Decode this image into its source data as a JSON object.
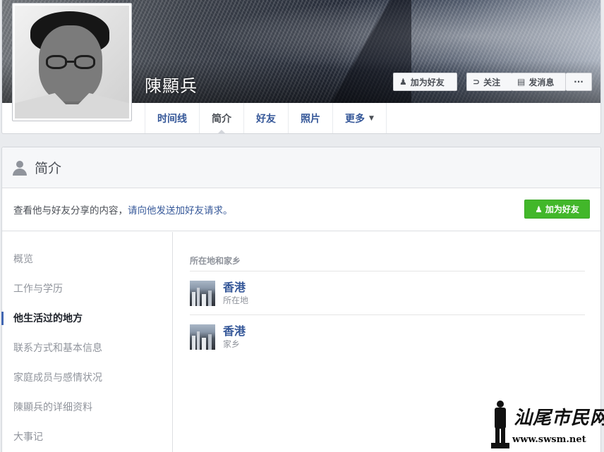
{
  "profile": {
    "name": "陳顯兵",
    "buttons": {
      "add_friend": "加为好友",
      "follow": "关注",
      "message": "发消息",
      "more": "···"
    },
    "icons": {
      "add_friend": "add-friend-icon",
      "follow": "rss-icon",
      "message": "message-icon"
    },
    "tabs": [
      {
        "label": "时间线",
        "active": false
      },
      {
        "label": "简介",
        "active": true
      },
      {
        "label": "好友",
        "active": false
      },
      {
        "label": "照片",
        "active": false
      },
      {
        "label": "更多",
        "active": false,
        "has_dropdown": true
      }
    ]
  },
  "about": {
    "title": "简介",
    "friend_request": {
      "text": "查看他与好友分享的内容，",
      "link": "请向他发送加好友请求。",
      "button": "加为好友"
    },
    "nav": [
      {
        "label": "概览",
        "active": false
      },
      {
        "label": "工作与学历",
        "active": false
      },
      {
        "label": "他生活过的地方",
        "active": true
      },
      {
        "label": "联系方式和基本信息",
        "active": false
      },
      {
        "label": "家庭成员与感情状况",
        "active": false
      },
      {
        "label": "陳顯兵的详细资料",
        "active": false
      },
      {
        "label": "大事记",
        "active": false
      }
    ],
    "places": {
      "heading": "所在地和家乡",
      "items": [
        {
          "name": "香港",
          "type": "所在地"
        },
        {
          "name": "香港",
          "type": "家乡"
        }
      ]
    }
  },
  "watermark": {
    "script": "汕尾市民网",
    "url": "www.swsm.net"
  },
  "colors": {
    "link_blue": "#365899",
    "green_button": "#42b72a",
    "muted_gray": "#90949c",
    "page_bg": "#e9ebee"
  }
}
